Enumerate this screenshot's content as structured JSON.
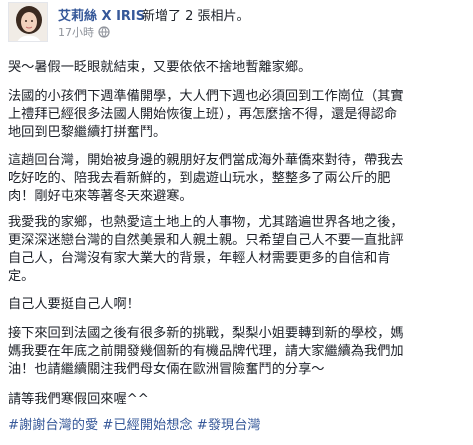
{
  "post": {
    "author": "艾莉絲 X IRIS",
    "action": "新增了 2 張相片。",
    "time": "17小時",
    "paragraphs": [
      "哭～暑假一眨眼就結束，又要依依不捨地暫離家鄉。",
      "法國的小孩們下週準備開學，大人們下週也必須回到工作崗位（其實\n上禮拜已經很多法國人開始恢復上班），再怎麼捨不得，還是得認命\n地回到巴黎繼續打拼奮鬥。",
      "這趟回台灣，開始被身邊的親朋好友們當成海外華僑來對待，帶我去\n吃好吃的、陪我去看新鮮的，到處遊山玩水，整整多了兩公斤的肥\n肉！剛好屯來等著冬天來避寒。",
      "我愛我的家鄉，也熱愛這土地上的人事物，尤其踏遍世界各地之後，\n更深深迷戀台灣的自然美景和人親土親。只希望自己人不要一直批評\n自己人，台灣沒有家大業大的背景，年輕人材需要更多的自信和肯\n定。",
      "自己人要挺自己人啊！",
      "接下來回到法國之後有很多新的挑戰，梨梨小姐要轉到新的學校，媽\n媽我要在年底之前開發幾個新的有機品牌代理，請大家繼續為我們加\n油！也請繼續關注我們母女倆在歐洲冒險奮鬥的分享～",
      "請等我們寒假回來喔^^"
    ],
    "hashtags": [
      "#謝謝台灣的愛",
      "#已經開始想念",
      "#發現台灣"
    ]
  }
}
